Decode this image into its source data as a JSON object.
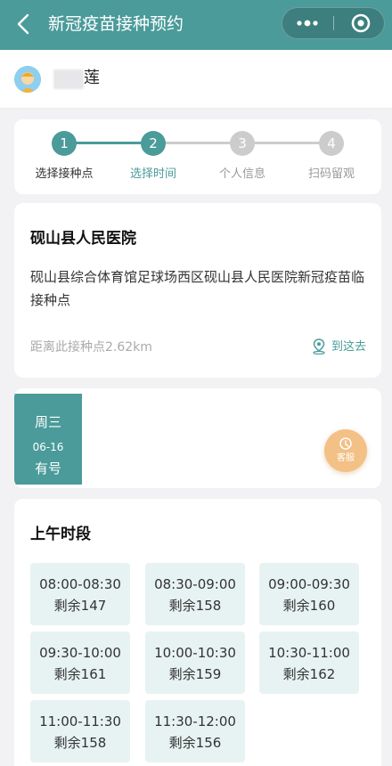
{
  "navbar": {
    "title": "新冠疫苗接种预约"
  },
  "user": {
    "name": "莲"
  },
  "steps": [
    {
      "number": "1",
      "label": "选择接种点"
    },
    {
      "number": "2",
      "label": "选择时间"
    },
    {
      "number": "3",
      "label": "个人信息"
    },
    {
      "number": "4",
      "label": "扫码留观"
    }
  ],
  "current_step": 2,
  "colors": {
    "accent": "#4a9b9a",
    "inactive": "#cccccc",
    "slot_bg": "#e7f3f2",
    "service_button": "#f3c086"
  },
  "site": {
    "name": "砚山县人民医院",
    "address": "砚山县综合体育馆足球场西区砚山县人民医院新冠疫苗临接种点",
    "distance": "距离此接种点2.62km",
    "navigate_label": "到这去"
  },
  "date": {
    "weekday": "周三",
    "day": "06-16",
    "status": "有号"
  },
  "service": {
    "label": "客服"
  },
  "morning": {
    "title": "上午时段",
    "slots": [
      {
        "time": "08:00-08:30",
        "remain": "剩余147"
      },
      {
        "time": "08:30-09:00",
        "remain": "剩余158"
      },
      {
        "time": "09:00-09:30",
        "remain": "剩余160"
      },
      {
        "time": "09:30-10:00",
        "remain": "剩余161"
      },
      {
        "time": "10:00-10:30",
        "remain": "剩余159"
      },
      {
        "time": "10:30-11:00",
        "remain": "剩余162"
      },
      {
        "time": "11:00-11:30",
        "remain": "剩余158"
      },
      {
        "time": "11:30-12:00",
        "remain": "剩余156"
      }
    ]
  }
}
